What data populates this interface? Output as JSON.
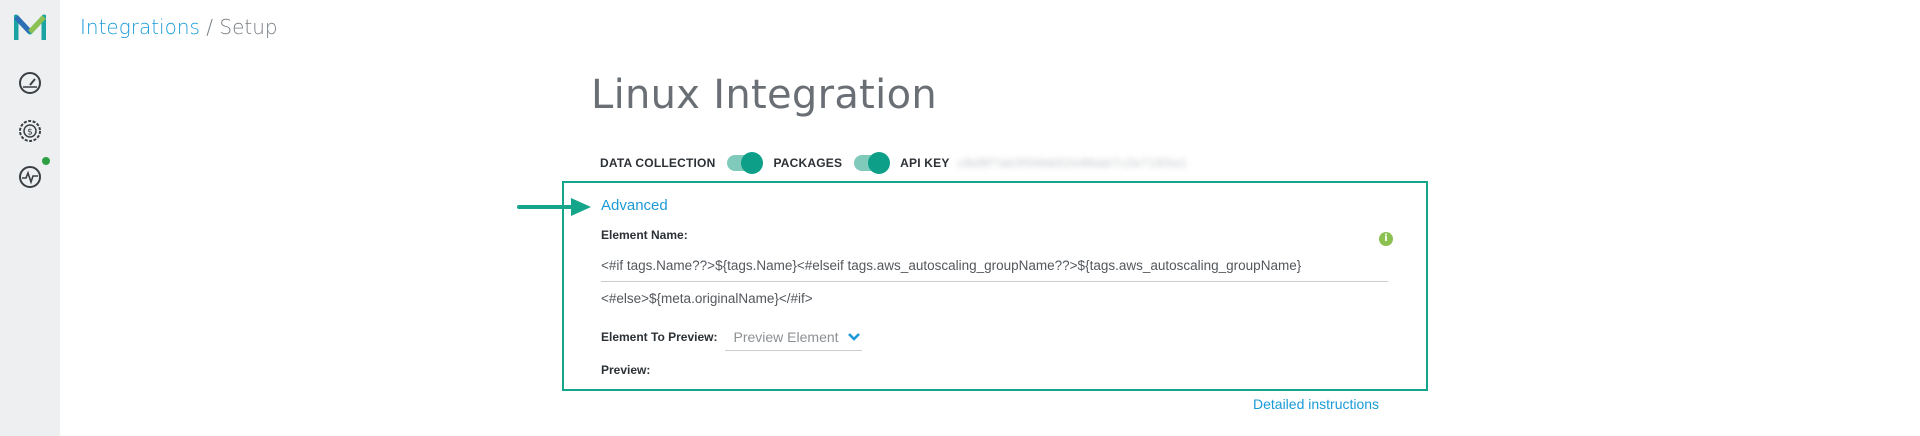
{
  "breadcrumb": {
    "link": "Integrations",
    "separator": " / ",
    "current": "Setup"
  },
  "sidebar": {
    "items": [
      {
        "icon": "dashboard-gauge-icon"
      },
      {
        "icon": "billing-coin-icon"
      },
      {
        "icon": "monitoring-pulse-icon",
        "has_status_dot": true
      }
    ],
    "status_dot_color": "#2ea043"
  },
  "page": {
    "title": "Linux Integration"
  },
  "toggles": {
    "data_collection_label": "DATA COLLECTION",
    "data_collection_on": true,
    "packages_label": "PACKAGES",
    "packages_on": true,
    "api_key_label": "API KEY",
    "api_key_value": "c8d9f7ab3f04bb52e86ab7c2e7193a1"
  },
  "advanced": {
    "link": "Advanced",
    "element_name_label": "Element Name:",
    "template_line1": "<#if tags.Name??>${tags.Name}<#elseif tags.aws_autoscaling_groupName??>${tags.aws_autoscaling_groupName}",
    "template_line2": "<#else>${meta.originalName}</#if>",
    "element_to_preview_label": "Element To Preview:",
    "preview_select_value": "Preview Element",
    "preview_label": "Preview:",
    "info_icon_glyph": "i"
  },
  "footer": {
    "detailed_instructions": "Detailed instructions"
  },
  "colors": {
    "accent_teal": "#14a58a",
    "toggle_track": "#7fcabb",
    "toggle_knob": "#0d9f88",
    "link_blue": "#1a9bd7",
    "info_green": "#8cc152"
  }
}
